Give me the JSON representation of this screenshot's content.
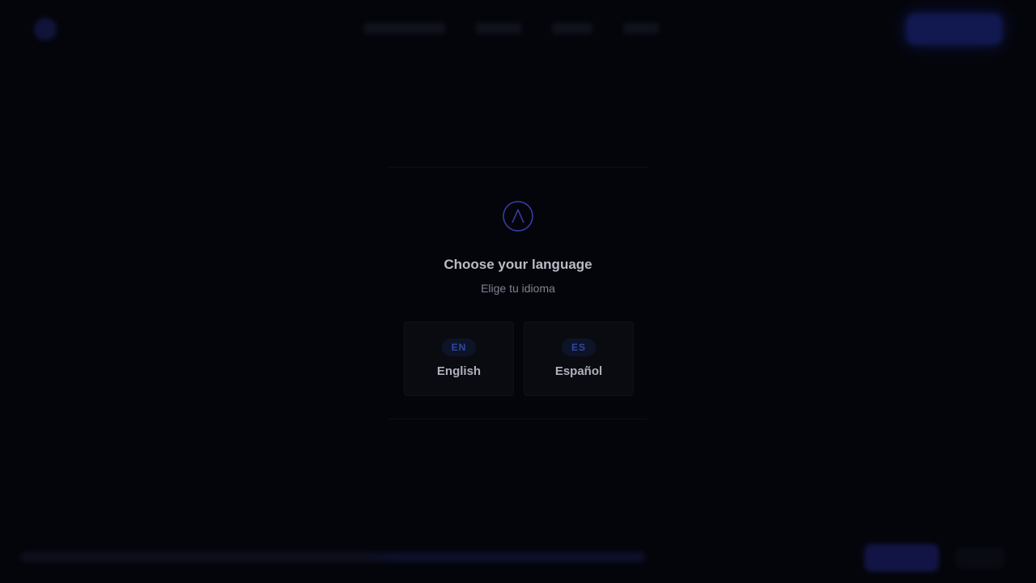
{
  "modal": {
    "title": "Choose your language",
    "subtitle": "Elige tu idioma",
    "logo_icon": "chevron-up-circle-icon",
    "options": [
      {
        "code": "EN",
        "label": "English"
      },
      {
        "code": "ES",
        "label": "Español"
      }
    ]
  },
  "colors": {
    "background": "#04050b",
    "accent": "#2f48a6",
    "title_text": "#b9bcc6",
    "subtitle_text": "#7f8392",
    "logo_stroke": "#3a3fa8"
  }
}
